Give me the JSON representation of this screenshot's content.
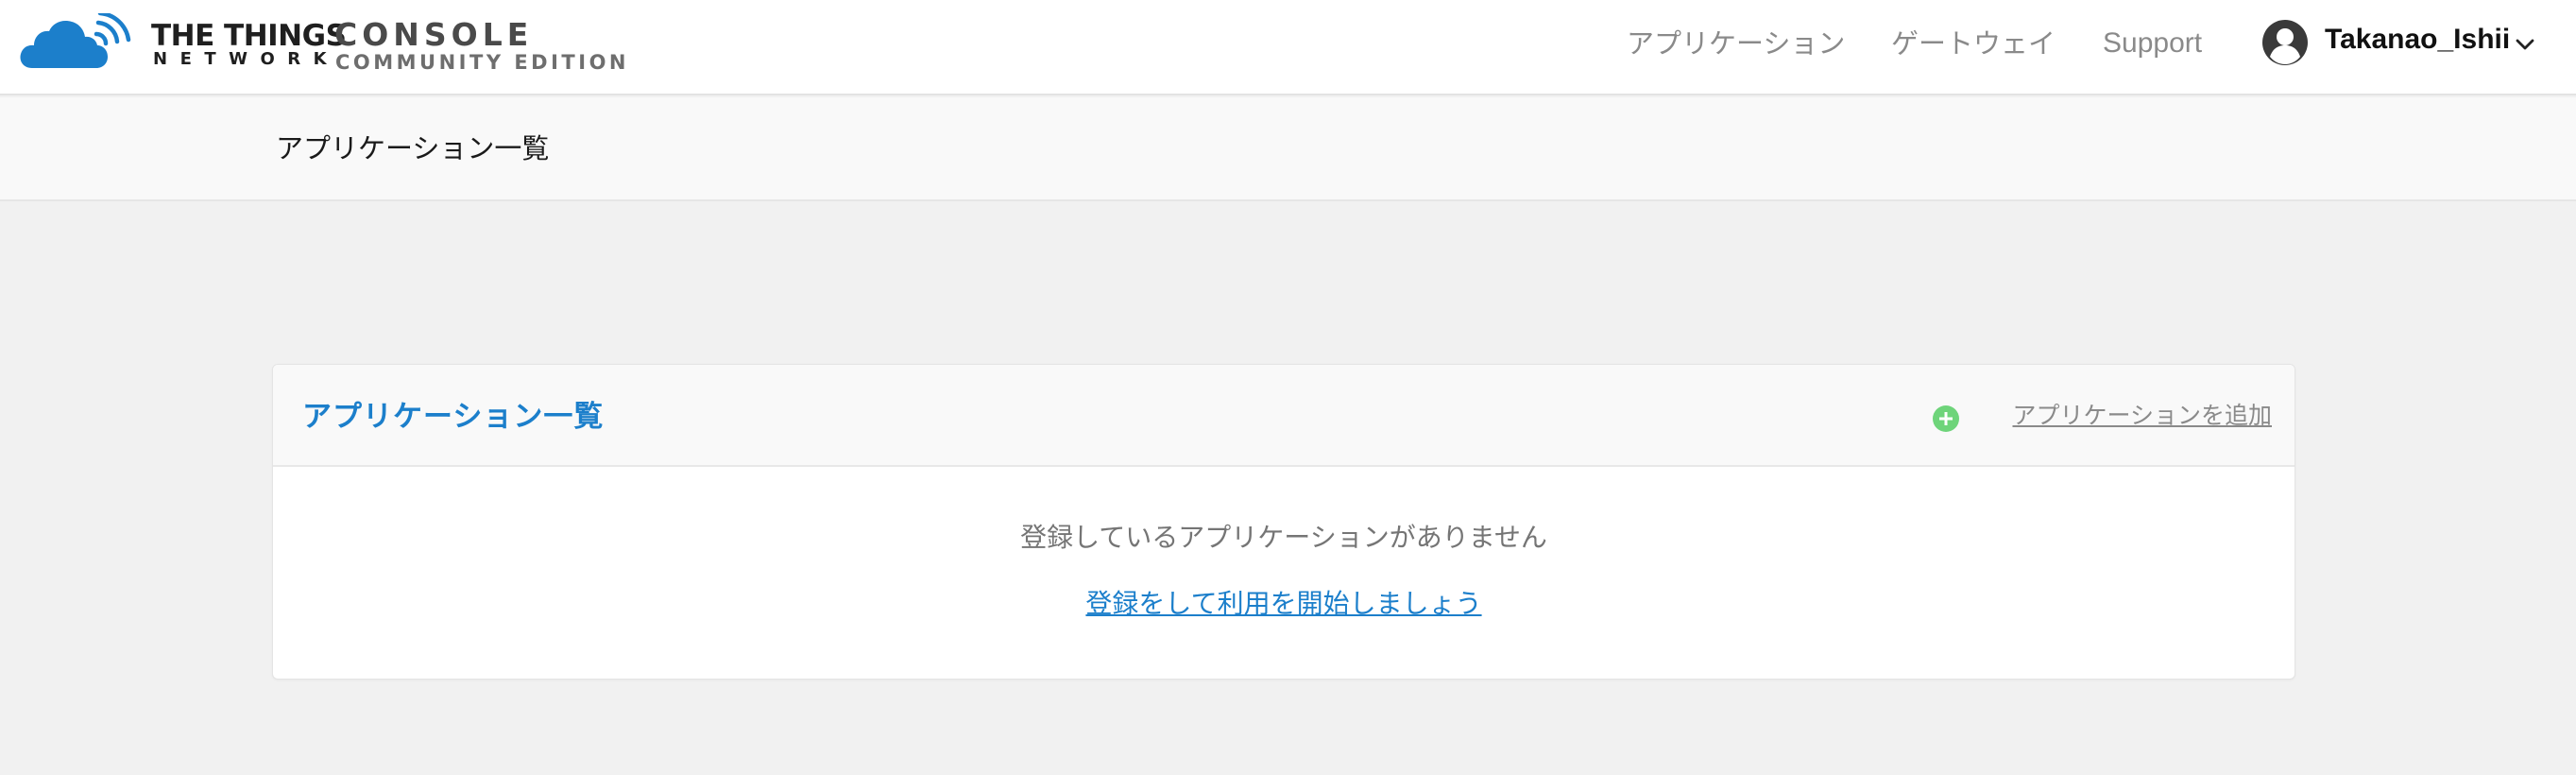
{
  "brand": {
    "name_line1": "THE THINGS",
    "name_line2": "NETWORK",
    "product": "CONSOLE",
    "edition": "COMMUNITY EDITION",
    "logo_icon": "ttn-cloud-icon",
    "logo_color": "#1c7fcb"
  },
  "nav": {
    "items": [
      {
        "label": "アプリケーション"
      },
      {
        "label": "ゲートウェイ"
      },
      {
        "label": "Support"
      }
    ]
  },
  "user": {
    "name": "Takanao_Ishii",
    "avatar_icon": "user-avatar-icon",
    "menu_icon": "chevron-down-icon"
  },
  "breadcrumb": {
    "current": "アプリケーション一覧"
  },
  "card": {
    "title": "アプリケーション一覧",
    "add_label": "アプリケーションを追加",
    "add_icon": "plus-circle-icon",
    "add_icon_color": "#6ed47a",
    "empty_message": "登録しているアプリケーションがありません",
    "register_link": "登録をして利用を開始しましょう"
  },
  "colors": {
    "accent": "#1c7fcb",
    "page_background": "#f1f1f1",
    "header_background": "#ffffff",
    "muted_text": "#8a8a8a"
  }
}
